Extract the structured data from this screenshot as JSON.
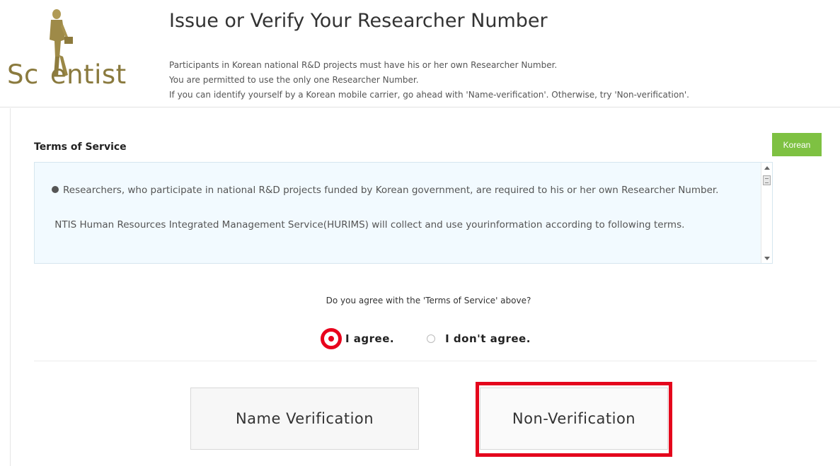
{
  "header": {
    "logo_text_left": "Sc",
    "logo_text_right": "entist",
    "title": "Issue or Verify Your Researcher Number",
    "intro": [
      "Participants in Korean national R&D projects must have his or her own Researcher Number.",
      "You are permitted to use the only one Researcher Number.",
      "If you can identify yourself by a Korean mobile carrier, go ahead with 'Name-verification'. Otherwise, try 'Non-verification'."
    ]
  },
  "terms": {
    "label": "Terms of Service",
    "language_button": "Korean",
    "paragraphs": [
      "Researchers, who participate in national R&D projects funded by Korean government, are required to his or her own Researcher Number.",
      "NTIS Human Resources Integrated Management Service(HURIMS) will collect and use yourinformation according to following terms."
    ]
  },
  "agreement": {
    "question": "Do you agree with the 'Terms of Service' above?",
    "agree_label": "I agree.",
    "disagree_label": "I don't agree.",
    "selected": "agree"
  },
  "actions": {
    "name_verification": "Name Verification",
    "non_verification": "Non-Verification"
  },
  "colors": {
    "logo": "#8a7a3e",
    "korean_button": "#7ec142",
    "highlight": "#e4051c",
    "terms_background": "#f2faff"
  }
}
